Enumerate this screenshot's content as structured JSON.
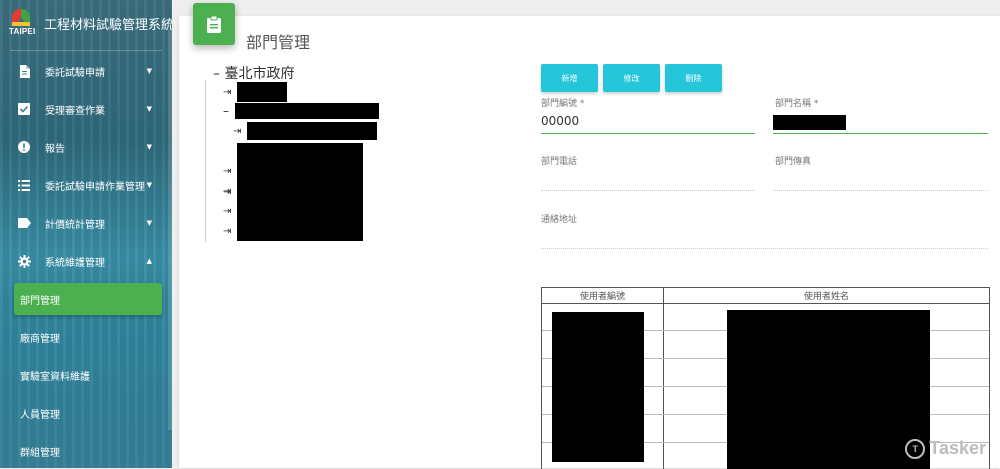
{
  "app": {
    "title": "工程材料試驗管理系統",
    "logo_text": "TAIPEI"
  },
  "sidebar": {
    "items": [
      {
        "label": "委託試驗申請",
        "icon": "document-icon",
        "expanded": false
      },
      {
        "label": "受理審查作業",
        "icon": "check-square-icon",
        "expanded": false
      },
      {
        "label": "報告",
        "icon": "alert-circle-icon",
        "expanded": false
      },
      {
        "label": "委託試驗申請作業管理",
        "icon": "list-icon",
        "expanded": false
      },
      {
        "label": "計價統計管理",
        "icon": "label-icon",
        "expanded": false
      },
      {
        "label": "系統維護管理",
        "icon": "gear-icon",
        "expanded": true
      }
    ],
    "sub_items": [
      {
        "label": "部門管理",
        "active": true
      },
      {
        "label": "廠商管理",
        "active": false
      },
      {
        "label": "實驗室資料維護",
        "active": false
      },
      {
        "label": "人員管理",
        "active": false
      },
      {
        "label": "群組管理",
        "active": false
      }
    ]
  },
  "page": {
    "title": "部門管理",
    "icon": "clipboard-icon"
  },
  "tree": {
    "root_label": "臺北市政府"
  },
  "toolbar": {
    "add_label": "新增",
    "edit_label": "修改",
    "delete_label": "刪除",
    "accent": "#26c6da"
  },
  "form": {
    "dept_no_label": "部門編號 *",
    "dept_no_value": "00000",
    "dept_name_label": "部門名稱 *",
    "dept_phone_label": "部門電話",
    "dept_fax_label": "部門傳真",
    "address_label": "通絡地址"
  },
  "table": {
    "headers": [
      "使用者編號",
      "使用者姓名"
    ]
  },
  "watermark": "Tasker",
  "colors": {
    "active_green": "#4caf50",
    "button_cyan": "#26c6da"
  }
}
